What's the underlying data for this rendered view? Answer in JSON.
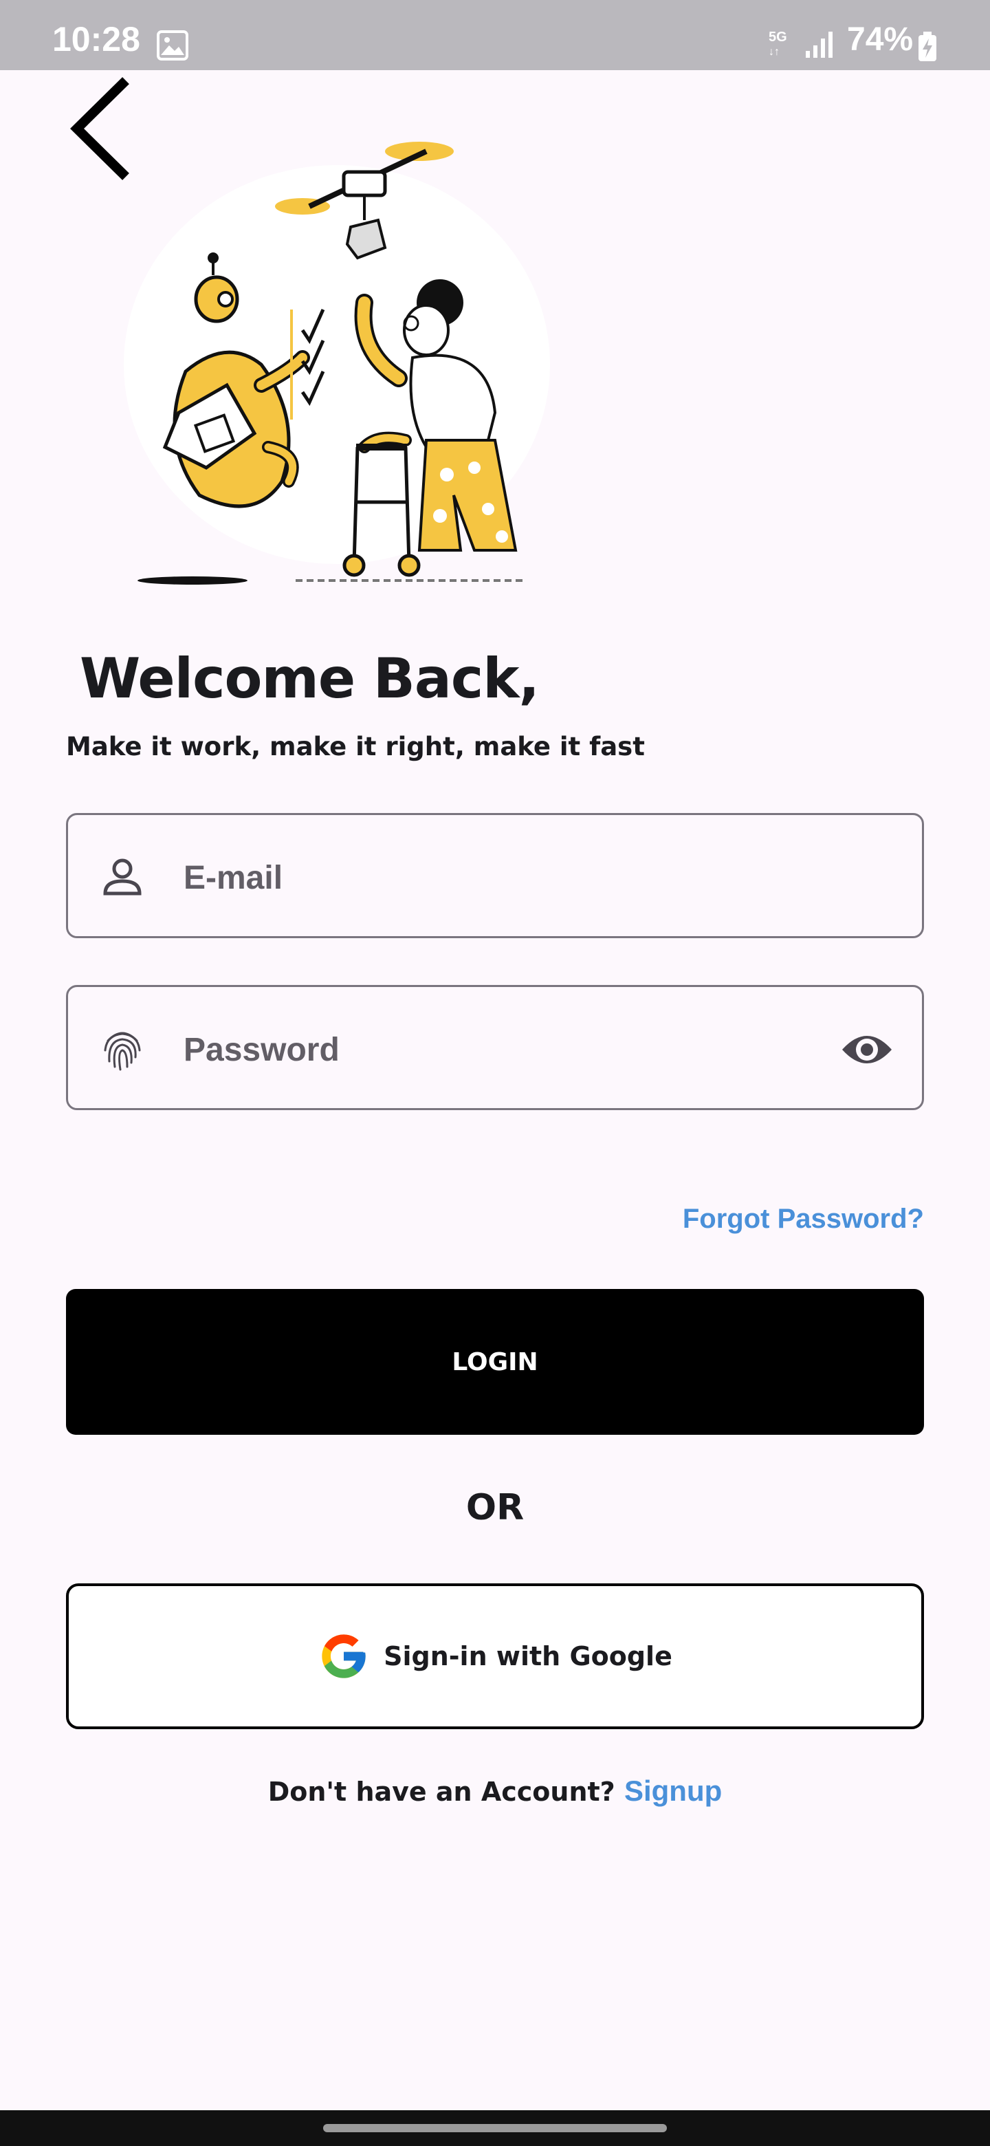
{
  "status_bar": {
    "time": "10:28",
    "network": "5G",
    "battery": "74%"
  },
  "header": {
    "title": "Welcome Back,",
    "subtitle": "Make it work, make it right, make it fast"
  },
  "form": {
    "email_placeholder": "E-mail",
    "password_placeholder": "Password",
    "forgot_password": "Forgot Password?",
    "login_label": "LOGIN"
  },
  "divider": {
    "or_label": "OR"
  },
  "google": {
    "label": "Sign-in with Google"
  },
  "signup": {
    "prompt": "Don't have an Account?",
    "link": "Signup"
  },
  "colors": {
    "accent": "#4a90d9",
    "primary": "#000000",
    "illustration_yellow": "#f5c542",
    "background": "#fdf8fd"
  },
  "icons": {
    "back": "chevron-left-icon",
    "email": "person-icon",
    "password": "fingerprint-icon",
    "visibility": "eye-icon",
    "google": "google-g-icon"
  }
}
